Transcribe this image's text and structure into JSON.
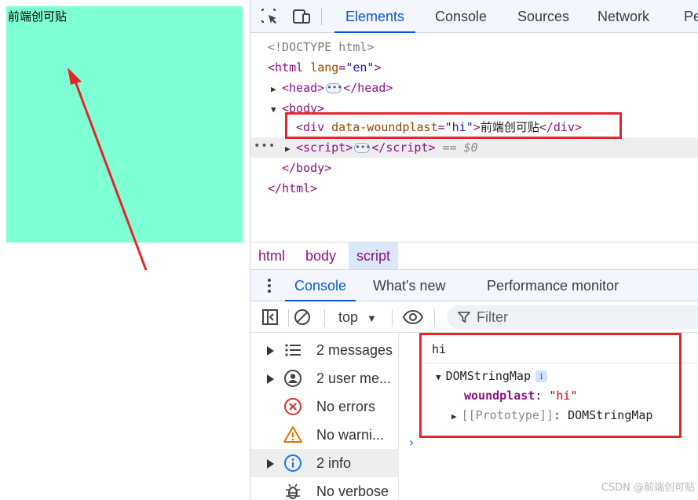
{
  "preview": {
    "text": "前端创可贴",
    "background_color": "#7fffd4"
  },
  "devtools": {
    "tabs": [
      {
        "label": "Elements",
        "active": true
      },
      {
        "label": "Console",
        "active": false
      },
      {
        "label": "Sources",
        "active": false
      },
      {
        "label": "Network",
        "active": false
      },
      {
        "label": "Pe",
        "active": false
      }
    ],
    "toolbar_icons": [
      "inspect-element-icon",
      "device-toolbar-icon"
    ],
    "dom": {
      "doctype": "<!DOCTYPE html>",
      "html_open_tag": "html",
      "html_attr_name": "lang",
      "html_attr_value": "\"en\"",
      "head_tag": "head",
      "body_tag": "body",
      "div_tag": "div",
      "div_attr_name": "data-woundplast",
      "div_attr_value": "\"hi\"",
      "div_text": "前端创可贴",
      "script_tag": "script",
      "selected_marker": "== $0",
      "html_close": "</html>",
      "body_close": "</body>"
    },
    "breadcrumb": [
      {
        "label": "html",
        "active": false
      },
      {
        "label": "body",
        "active": false
      },
      {
        "label": "script",
        "active": true
      }
    ],
    "drawer_tabs": [
      {
        "label": "Console",
        "active": true
      },
      {
        "label": "What's new",
        "active": false
      },
      {
        "label": "Performance monitor",
        "active": false
      }
    ],
    "console_toolbar": {
      "context": "top",
      "filter_placeholder": "Filter"
    },
    "sidebar": [
      {
        "label": "2 messages",
        "icon": "list-icon",
        "expandable": true
      },
      {
        "label": "2 user me...",
        "icon": "user-icon",
        "expandable": true
      },
      {
        "label": "No errors",
        "icon": "error-icon",
        "expandable": false
      },
      {
        "label": "No warni...",
        "icon": "warning-icon",
        "expandable": false
      },
      {
        "label": "2 info",
        "icon": "info-icon",
        "expandable": true,
        "active": true
      },
      {
        "label": "No verbose",
        "icon": "bug-icon",
        "expandable": false
      }
    ],
    "output": {
      "log_text": "hi",
      "object_name": "DOMStringMap",
      "info_badge": "i",
      "prop_key": "woundplast",
      "prop_value": "\"hi\"",
      "proto_label": "[[Prototype]]",
      "proto_value": "DOMStringMap"
    },
    "colors": {
      "accent": "#0b57d0",
      "highlight_border": "#e3262b",
      "tag": "#881280"
    }
  },
  "watermark": "CSDN @前端创可贴"
}
